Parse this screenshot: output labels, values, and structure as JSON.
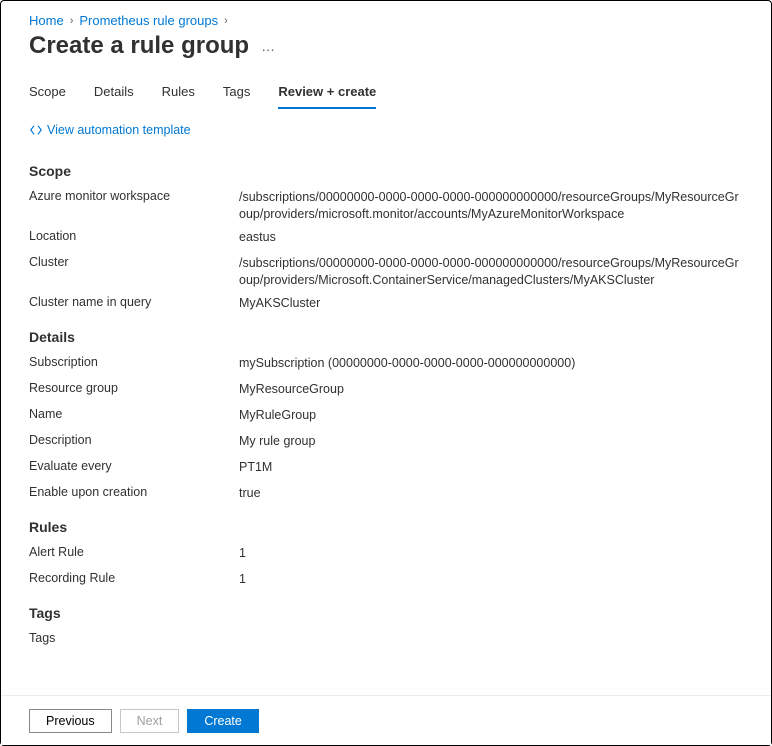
{
  "breadcrumb": {
    "home": "Home",
    "parent": "Prometheus rule groups"
  },
  "pageTitle": "Create a rule group",
  "tabs": {
    "scope": "Scope",
    "details": "Details",
    "rules": "Rules",
    "tags": "Tags",
    "review": "Review + create"
  },
  "automationLink": "View automation template",
  "sections": {
    "scope": {
      "heading": "Scope",
      "rows": {
        "workspace": {
          "label": "Azure monitor workspace",
          "value": "/subscriptions/00000000-0000-0000-0000-000000000000/resourceGroups/MyResourceGroup/providers/microsoft.monitor/accounts/MyAzureMonitorWorkspace"
        },
        "location": {
          "label": "Location",
          "value": "eastus"
        },
        "cluster": {
          "label": "Cluster",
          "value": "/subscriptions/00000000-0000-0000-0000-000000000000/resourceGroups/MyResourceGroup/providers/Microsoft.ContainerService/managedClusters/MyAKSCluster"
        },
        "clusterNameInQuery": {
          "label": "Cluster name in query",
          "value": "MyAKSCluster"
        }
      }
    },
    "details": {
      "heading": "Details",
      "rows": {
        "subscription": {
          "label": "Subscription",
          "value": "mySubscription (00000000-0000-0000-0000-000000000000)"
        },
        "resourceGroup": {
          "label": "Resource group",
          "value": "MyResourceGroup"
        },
        "name": {
          "label": "Name",
          "value": "MyRuleGroup"
        },
        "description": {
          "label": "Description",
          "value": "My rule group"
        },
        "evaluateEvery": {
          "label": "Evaluate every",
          "value": "PT1M"
        },
        "enableUponCreation": {
          "label": "Enable upon creation",
          "value": "true"
        }
      }
    },
    "rulesSection": {
      "heading": "Rules",
      "rows": {
        "alertRule": {
          "label": "Alert Rule",
          "value": "1"
        },
        "recordingRule": {
          "label": "Recording Rule",
          "value": "1"
        }
      }
    },
    "tagsSection": {
      "heading": "Tags",
      "rows": {
        "tags": {
          "label": "Tags",
          "value": ""
        }
      }
    }
  },
  "footer": {
    "previous": "Previous",
    "next": "Next",
    "create": "Create"
  }
}
